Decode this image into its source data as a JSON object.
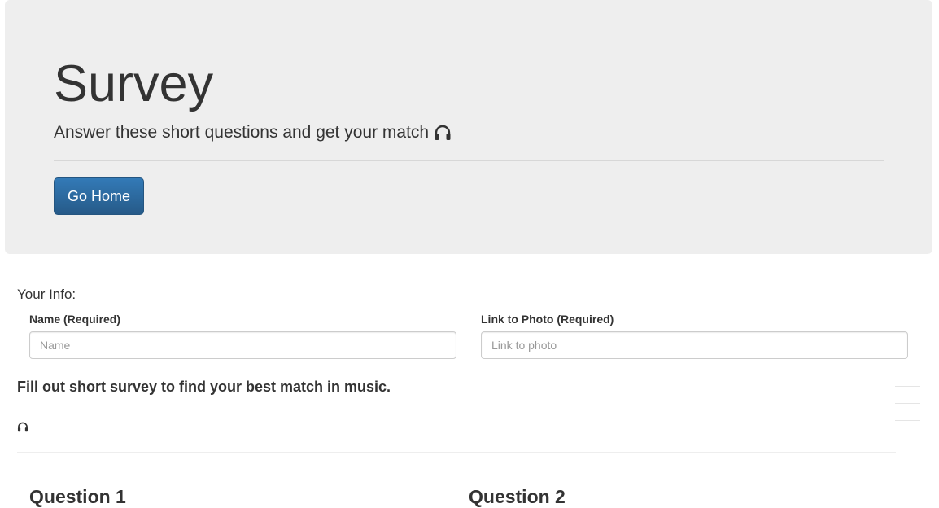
{
  "header": {
    "title": "Survey",
    "lead": "Answer these short questions and get your match",
    "lead_icon": "headphones-icon",
    "home_button_label": "Go Home"
  },
  "info": {
    "section_label": "Your Info:",
    "name": {
      "label": "Name (Required)",
      "value": "",
      "placeholder": "Name"
    },
    "photo": {
      "label": "Link to Photo (Required)",
      "value": "",
      "placeholder": "Link to photo"
    }
  },
  "survey": {
    "intro": "Fill out short survey to find your best match in music.",
    "intro_icon": "headphones-icon",
    "questions": [
      {
        "title": "Question 1"
      },
      {
        "title": "Question 2"
      }
    ]
  }
}
